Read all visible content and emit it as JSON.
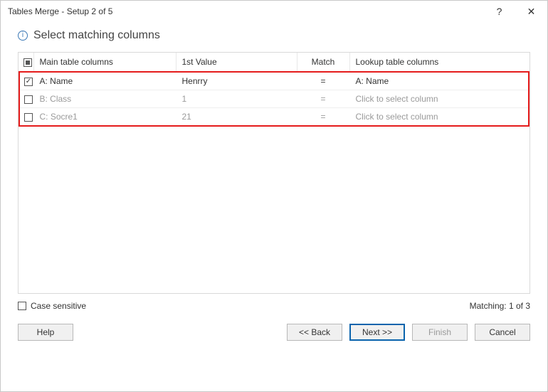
{
  "titlebar": {
    "title": "Tables Merge - Setup 2 of 5",
    "help_glyph": "?",
    "close_glyph": "✕"
  },
  "heading": {
    "info_glyph": "i",
    "text": "Select matching columns"
  },
  "table": {
    "headers": {
      "main": "Main table columns",
      "first_value": "1st Value",
      "match": "Match",
      "lookup": "Lookup table columns"
    },
    "rows": [
      {
        "checked": true,
        "main": "A: Name",
        "value": "Henrry",
        "match": "=",
        "lookup": "A: Name",
        "lookup_placeholder": false
      },
      {
        "checked": false,
        "main": "B: Class",
        "value": "1",
        "match": "=",
        "lookup": "Click to select column",
        "lookup_placeholder": true
      },
      {
        "checked": false,
        "main": "C: Socre1",
        "value": "21",
        "match": "=",
        "lookup": "Click to select column",
        "lookup_placeholder": true
      }
    ]
  },
  "case_sensitive_label": "Case sensitive",
  "matching_label": "Matching: 1 of 3",
  "buttons": {
    "help": "Help",
    "back": "<< Back",
    "next": "Next >>",
    "finish": "Finish",
    "cancel": "Cancel"
  }
}
